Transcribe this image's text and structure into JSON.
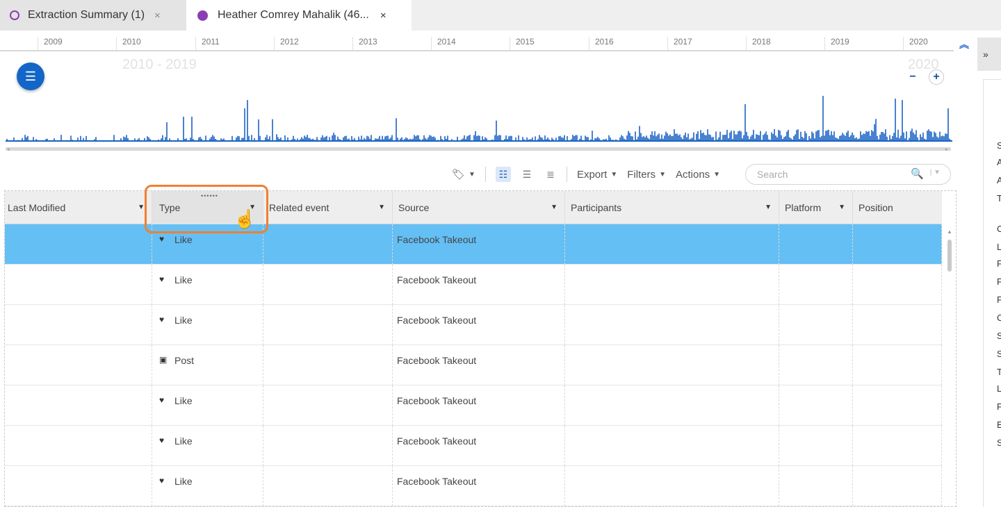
{
  "tabs": [
    {
      "label": "Extraction Summary (1)",
      "close": "×"
    },
    {
      "label": "Heather Comrey Mahalik (46...",
      "close": "×"
    }
  ],
  "timeline": {
    "years": [
      "2009",
      "2010",
      "2011",
      "2012",
      "2013",
      "2014",
      "2015",
      "2016",
      "2017",
      "2018",
      "2019",
      "2020"
    ],
    "range_label": "2010 - 2019",
    "range_label_right": "2020",
    "zoom_out": "−",
    "zoom_in": "+",
    "accent": "#1366c8"
  },
  "toolbar": {
    "export": "Export",
    "filters": "Filters",
    "actions": "Actions",
    "search_placeholder": "Search"
  },
  "right_panel": {
    "toggle": "»",
    "letters": [
      "S",
      "A",
      "A",
      "T",
      "C",
      "L",
      "F",
      "F",
      "F",
      "C",
      "S",
      "S",
      "T",
      "L",
      "F",
      "E",
      "S"
    ]
  },
  "table": {
    "columns": [
      "Last Modified",
      "Type",
      "Related event",
      "Source",
      "Participants",
      "Platform",
      "Position"
    ],
    "rows": [
      {
        "last_modified": "",
        "type": "Like",
        "type_icon": "heart-icon",
        "related_event": "",
        "source": "Facebook Takeout",
        "participants": "",
        "platform": "",
        "position": "",
        "selected": true
      },
      {
        "last_modified": "",
        "type": "Like",
        "type_icon": "heart-icon",
        "related_event": "",
        "source": "Facebook Takeout",
        "participants": "",
        "platform": "",
        "position": ""
      },
      {
        "last_modified": "",
        "type": "Like",
        "type_icon": "heart-icon",
        "related_event": "",
        "source": "Facebook Takeout",
        "participants": "",
        "platform": "",
        "position": ""
      },
      {
        "last_modified": "",
        "type": "Post",
        "type_icon": "post-icon",
        "related_event": "",
        "source": "Facebook Takeout",
        "participants": "",
        "platform": "",
        "position": ""
      },
      {
        "last_modified": "",
        "type": "Like",
        "type_icon": "heart-icon",
        "related_event": "",
        "source": "Facebook Takeout",
        "participants": "",
        "platform": "",
        "position": ""
      },
      {
        "last_modified": "",
        "type": "Like",
        "type_icon": "heart-icon",
        "related_event": "",
        "source": "Facebook Takeout",
        "participants": "",
        "platform": "",
        "position": ""
      },
      {
        "last_modified": "",
        "type": "Like",
        "type_icon": "heart-icon",
        "related_event": "",
        "source": "Facebook Takeout",
        "participants": "",
        "platform": "",
        "position": ""
      }
    ],
    "selected_color": "#64bff5"
  },
  "highlight_color": "#f08030"
}
